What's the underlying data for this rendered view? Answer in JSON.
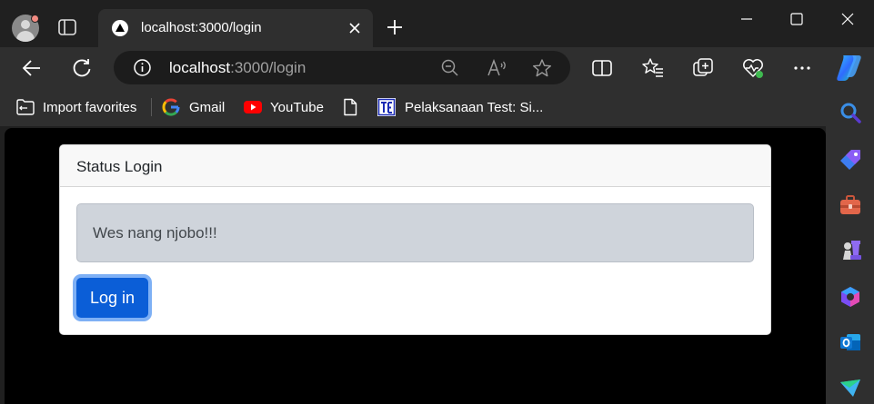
{
  "browser": {
    "tab": {
      "title": "localhost:3000/login"
    },
    "address": {
      "host": "localhost",
      "path": ":3000/login"
    },
    "bookmarks": [
      {
        "label": "Import favorites",
        "icon": "import-folder-icon"
      },
      {
        "label": "Gmail",
        "icon": "google-icon"
      },
      {
        "label": "YouTube",
        "icon": "youtube-icon"
      },
      {
        "label": "",
        "icon": "document-icon"
      },
      {
        "label": "Pelaksanaan Test: Si...",
        "icon": "te-site-icon"
      }
    ],
    "sidebar_icons": [
      "search-icon",
      "shopping-tag-icon",
      "tools-briefcase-icon",
      "games-chess-icon",
      "copilot-icon",
      "outlook-icon",
      "send-icon"
    ]
  },
  "page": {
    "card_title": "Status Login",
    "alert_text": "Wes nang njobo!!!",
    "login_button": "Log in"
  },
  "colors": {
    "accent": "#0b5ed7",
    "alert_bg": "#cfd4db",
    "page_bg": "#000000"
  }
}
